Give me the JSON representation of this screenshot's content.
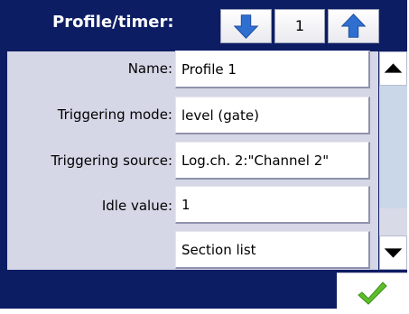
{
  "header": {
    "title": "Profile/timer:",
    "profile_number": "1",
    "prev_icon": "arrow-down-icon",
    "next_icon": "arrow-up-icon"
  },
  "fields": [
    {
      "label": "Name:",
      "value": "Profile 1"
    },
    {
      "label": "Triggering mode:",
      "value": "level (gate)"
    },
    {
      "label": "Triggering source:",
      "value": "Log.ch. 2:\"Channel 2\""
    },
    {
      "label": "Idle value:",
      "value": "1"
    },
    {
      "label": "",
      "value": "Section list"
    }
  ],
  "scrollbar": {
    "up_icon": "scroll-up-icon",
    "down_icon": "scroll-down-icon"
  },
  "footer": {
    "confirm_icon": "checkmark-icon"
  },
  "colors": {
    "frame": "#0d1d63",
    "panel": "#d5d6e6",
    "arrow_blue": "#2f6fd0",
    "check_green": "#5cbf2a"
  }
}
